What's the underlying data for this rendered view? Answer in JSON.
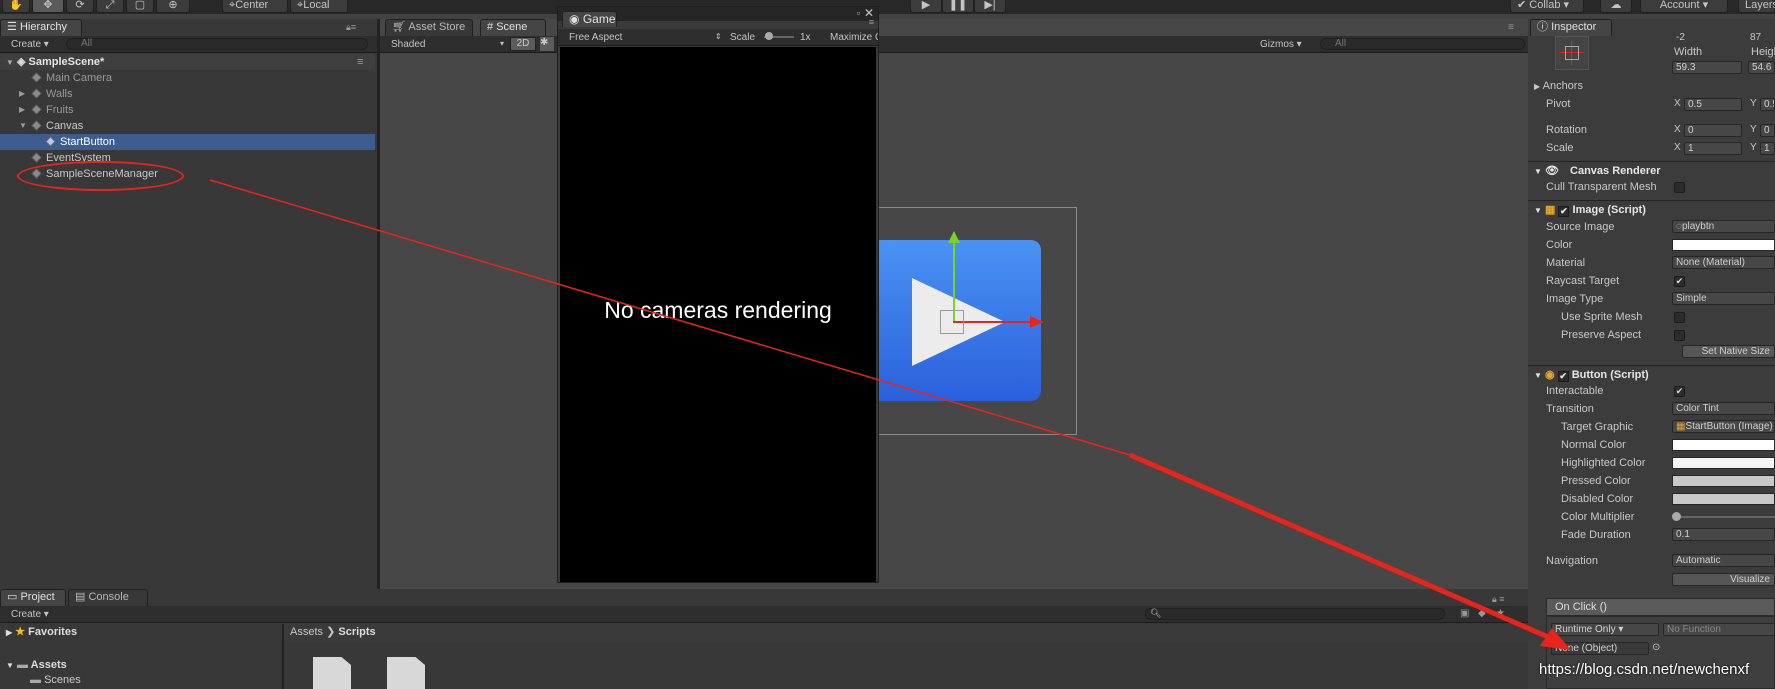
{
  "toolbar": {
    "center": "Center",
    "local": "Local",
    "collab": "Collab ▾",
    "account": "Account ▾",
    "layers": "Layers"
  },
  "hierarchy": {
    "tab": "Hierarchy",
    "create": "Create ▾",
    "search": "All",
    "scene": "SampleScene*",
    "items": [
      "Main Camera",
      "Walls",
      "Fruits",
      "Canvas",
      "StartButton",
      "EventSystem",
      "SampleSceneManager"
    ]
  },
  "scene_tabs": {
    "asset_store": "Asset Store",
    "scene": "Scene",
    "game": "Game"
  },
  "scene_bar": {
    "shaded": "Shaded",
    "two_d": "2D",
    "gizmos": "Gizmos ▾",
    "search": "All"
  },
  "game_bar": {
    "aspect": "Free Aspect",
    "scale": "Scale",
    "scale_val": "1x",
    "maximize": "Maximize On Play"
  },
  "game_view": {
    "message": "No cameras rendering"
  },
  "inspector": {
    "tab": "Inspector",
    "rect": {
      "width_label": "Width",
      "height_label": "Height",
      "width": "59.3",
      "height": "54.6",
      "top_x": "-2",
      "top_y": "87"
    },
    "anchors": "Anchors",
    "pivot": {
      "label": "Pivot",
      "x": "0.5",
      "y": "0.5"
    },
    "rotation": {
      "label": "Rotation",
      "x": "0",
      "y": "0"
    },
    "scale": {
      "label": "Scale",
      "x": "1",
      "y": "1"
    },
    "canvas_renderer": {
      "title": "Canvas Renderer",
      "cull": "Cull Transparent Mesh"
    },
    "image": {
      "title": "Image (Script)",
      "source_label": "Source Image",
      "source": "playbtn",
      "color_label": "Color",
      "material_label": "Material",
      "material": "None (Material)",
      "raycast_label": "Raycast Target",
      "type_label": "Image Type",
      "type": "Simple",
      "sprite_mesh": "Use Sprite Mesh",
      "preserve": "Preserve Aspect",
      "set_native": "Set Native Size"
    },
    "button": {
      "title": "Button (Script)",
      "interactable": "Interactable",
      "transition_label": "Transition",
      "transition": "Color Tint",
      "target_label": "Target Graphic",
      "target": "StartButton (Image)",
      "normal": "Normal Color",
      "highlighted": "Highlighted Color",
      "pressed": "Pressed Color",
      "disabled": "Disabled Color",
      "multiplier": "Color Multiplier",
      "fade_label": "Fade Duration",
      "fade": "0.1",
      "nav_label": "Navigation",
      "nav": "Automatic",
      "visualize": "Visualize"
    },
    "onclick": {
      "title": "On Click ()",
      "runtime": "Runtime Only ▾",
      "function": "No Function",
      "object": "None (Object)"
    }
  },
  "bottom": {
    "project_tab": "Project",
    "console_tab": "Console",
    "create": "Create ▾",
    "favorites": "Favorites",
    "assets": "Assets",
    "scenes": "Scenes",
    "crumb_assets": "Assets",
    "crumb_scripts": "Scripts"
  },
  "watermark": "https://blog.csdn.net/newchenxf",
  "colors": {
    "annotation": "#e8251c",
    "selection": "#3d5d91",
    "play_blue": "#2f6fe6"
  }
}
